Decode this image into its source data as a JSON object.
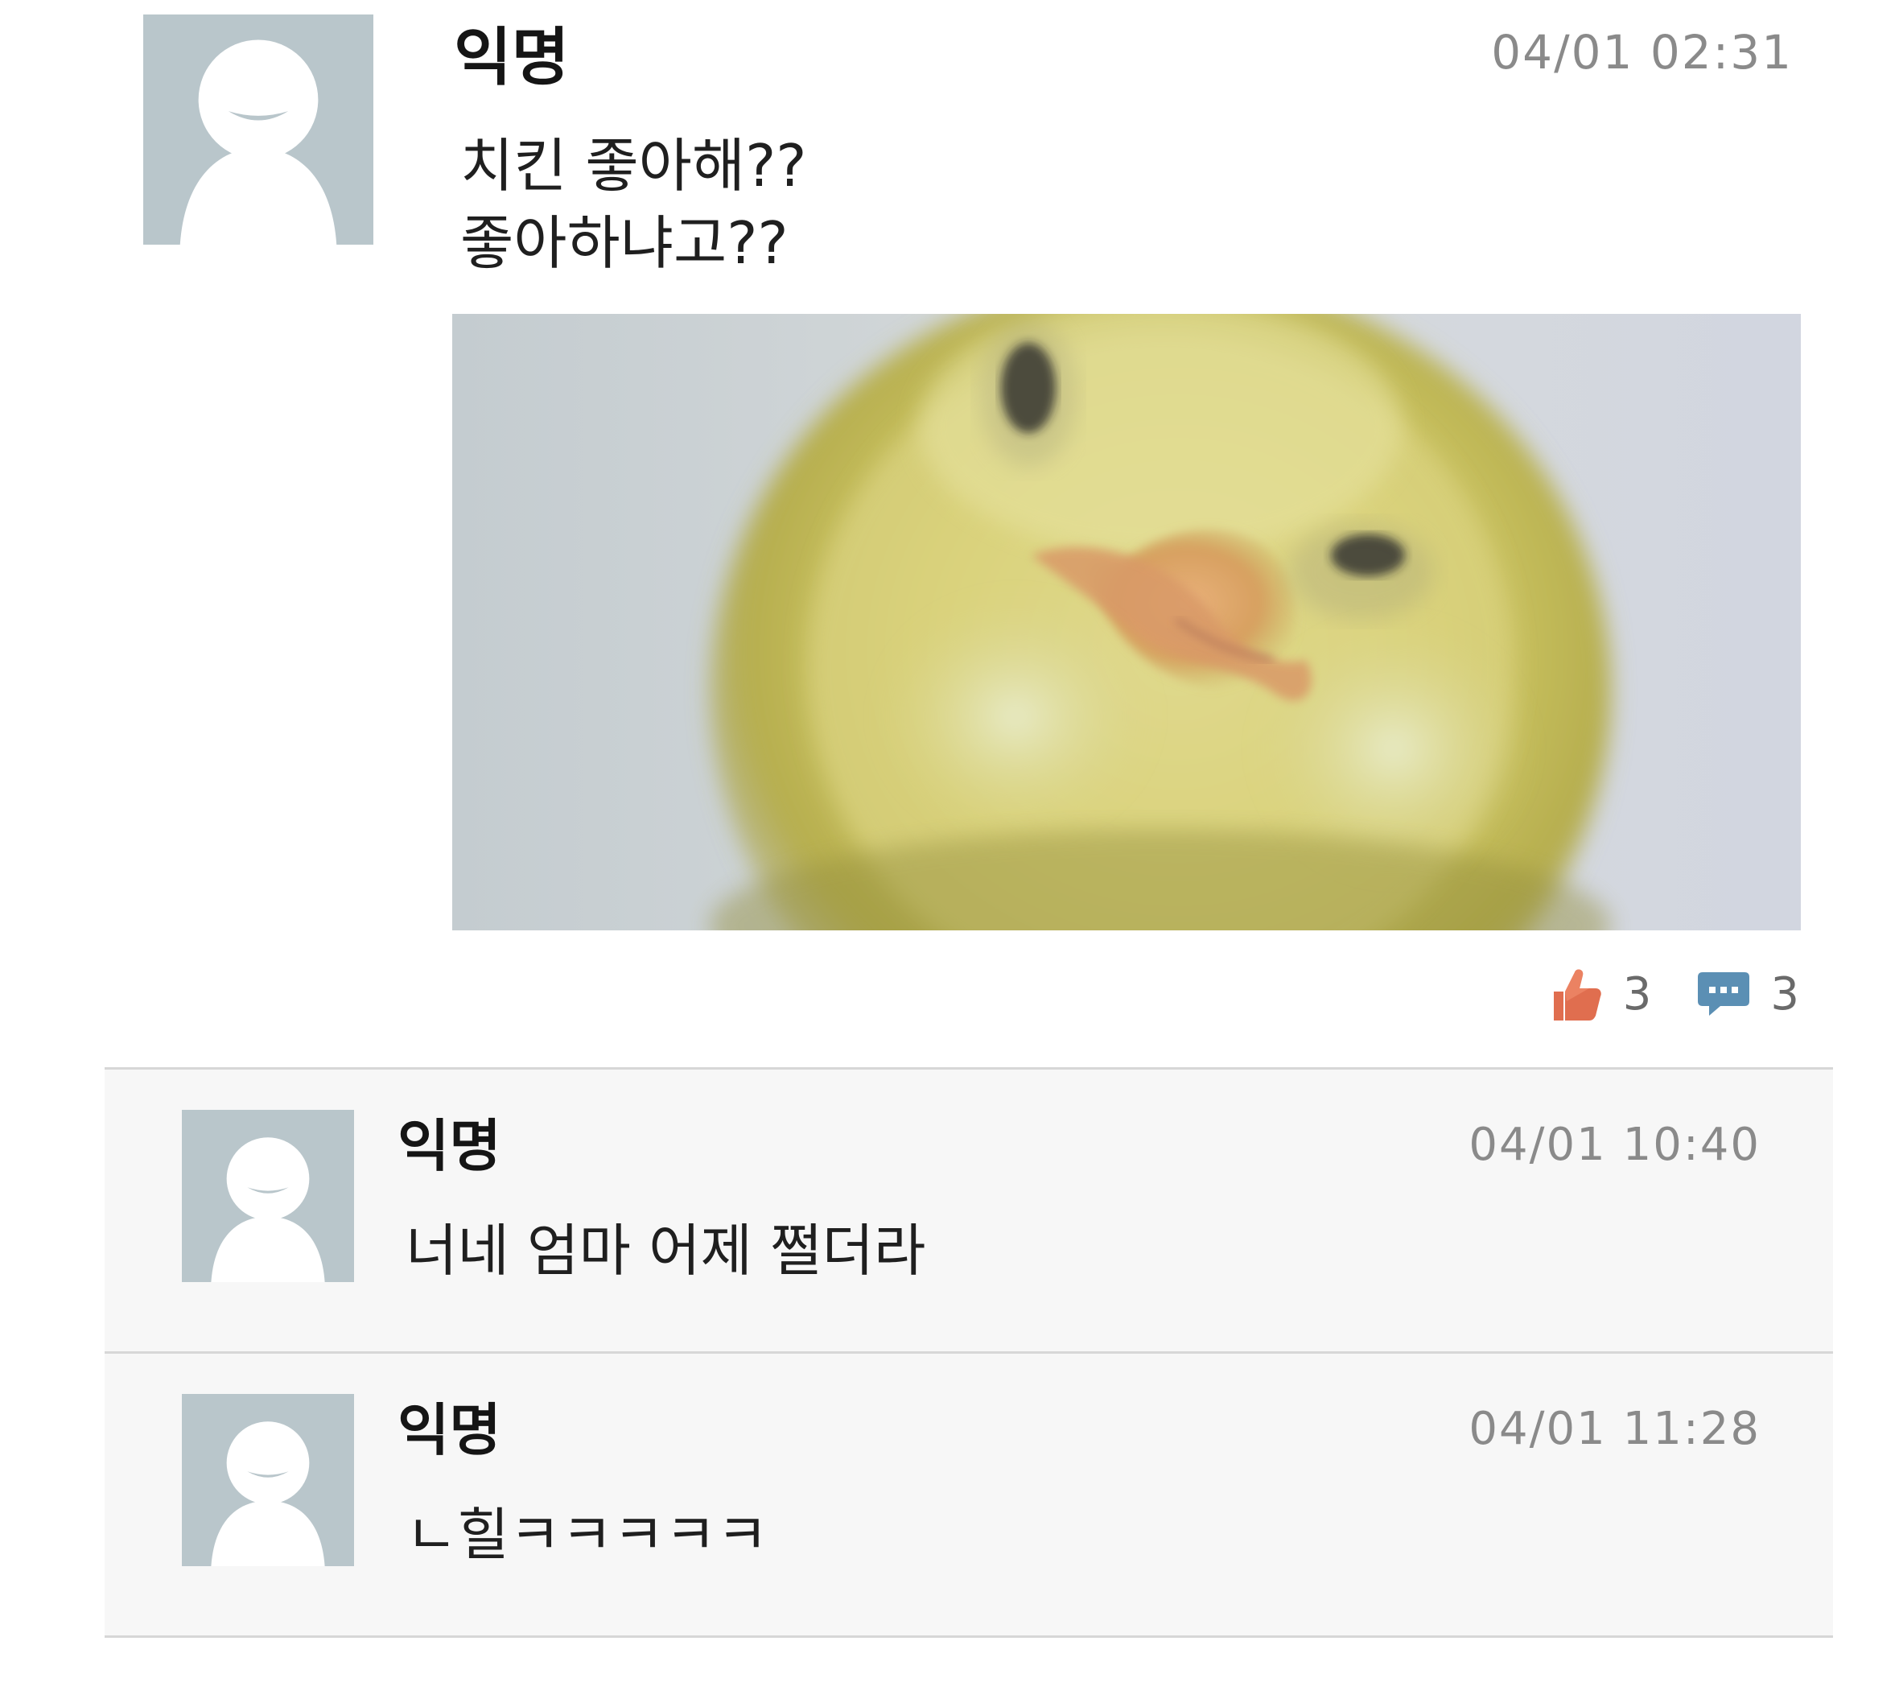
{
  "post": {
    "author": "익명",
    "time": "04/01 02:31",
    "text_lines": [
      "치킨 좋아해??",
      "좋아하냐고??"
    ],
    "photo_icon": "chick-closeup-photo",
    "likes": "3",
    "comments": "3",
    "like_icon": "thumbs-up-icon",
    "comment_icon": "speech-bubble-icon",
    "like_color": "#e06e4f",
    "comment_color": "#5b8fb4"
  },
  "comments": [
    {
      "author": "익명",
      "time": "04/01 10:40",
      "text": "너네 엄마 어제 쩔더라"
    },
    {
      "author": "익명",
      "time": "04/01 11:28",
      "text": "ㄴ힐ㅋㅋㅋㅋㅋ"
    }
  ],
  "avatar_icon": "default-avatar-icon",
  "colors": {
    "avatar_bg": "#b9c6cb",
    "avatar_fg": "#ffffff",
    "comment_bg": "#f7f7f7",
    "divider": "#d7d7d7",
    "time_text": "#8a8a8a"
  }
}
